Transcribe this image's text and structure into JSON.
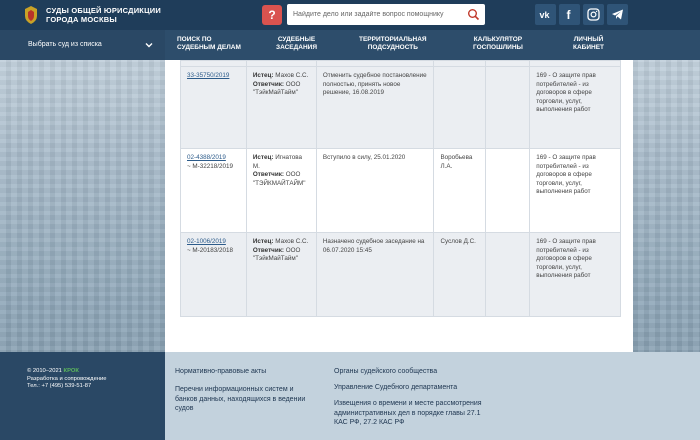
{
  "header": {
    "brand_line1": "СУДЫ ОБЩЕЙ ЮРИСДИКЦИИ",
    "brand_line2": "ГОРОДА МОСКВЫ",
    "help_label": "?",
    "search_placeholder": "Найдите дело или задайте вопрос помощнику",
    "social": [
      "vk-icon",
      "facebook-icon",
      "instagram-icon",
      "telegram-icon"
    ]
  },
  "nav": {
    "court_select": "Выбрать суд из списка",
    "items": [
      {
        "line1": "ПОИСК ПО",
        "line2": "СУДЕБНЫМ ДЕЛАМ"
      },
      {
        "line1": "СУДЕБНЫЕ",
        "line2": "ЗАСЕДАНИЯ"
      },
      {
        "line1": "ТЕРРИТОРИАЛЬНАЯ",
        "line2": "ПОДСУДНОСТЬ"
      },
      {
        "line1": "КАЛЬКУЛЯТОР",
        "line2": "ГОСПОШЛИНЫ"
      },
      {
        "line1": "ЛИЧНЫЙ",
        "line2": "КАБИНЕТ"
      }
    ]
  },
  "cases": [
    {
      "number": "33-35750/2019",
      "number_extra": "",
      "plaintiff_label": "Истец:",
      "plaintiff": "Махов С.С.",
      "defendant_label": "Ответчик:",
      "defendant": "ООО \"ТэйкМайТайм\"",
      "status": "Отменить судебное постановление полностью, принять новое решение, 16.08.2019",
      "judge": "",
      "category": "169 - О защите прав потребителей - из договоров в сфере торговли, услуг, выполнения работ"
    },
    {
      "number": "02-4388/2019",
      "number_extra": "~ М-32218/2019",
      "plaintiff_label": "Истец:",
      "plaintiff": "Игнатова М.",
      "defendant_label": "Ответчик:",
      "defendant": "ООО \"ТЭЙКМАЙТАЙМ\"",
      "status": "Вступило в силу, 25.01.2020",
      "judge": "Воробьева Л.А.",
      "category": "169 - О защите прав потребителей - из договоров в сфере торговли, услуг, выполнения работ"
    },
    {
      "number": "02-1006/2019",
      "number_extra": "~ М-20183/2018",
      "plaintiff_label": "Истец:",
      "plaintiff": "Махов С.С.",
      "defendant_label": "Ответчик:",
      "defendant": "ООО \"ТэйкМайТайм\"",
      "status": "Назначено судебное заседание на 06.07.2020 15:45",
      "judge": "Суслов Д.С.",
      "category": "169 - О защите прав потребителей - из договоров в сфере торговли, услуг, выполнения работ"
    }
  ],
  "footer": {
    "copyright_prefix": "© 2010–2021",
    "krok": "КРОК",
    "dev": "Разработка и сопровождение",
    "phone": "Тел.: +7 (495) 539-51-87",
    "links_col1": [
      "Нормативно-правовые акты",
      "Перечни информационных систем и банков данных, находящихся в ведении судов"
    ],
    "links_col2": [
      "Органы судейского сообщества",
      "Управление Судебного департамента",
      "Извещения о времени и месте рассмотрения административных дел в порядке главы 27.1 КАС РФ, 27.2 КАС РФ"
    ]
  },
  "colors": {
    "header_bg": "#1f3d5a",
    "nav_bg": "#2d4d6b",
    "help_red": "#d9534f",
    "link_blue": "#2c5b8a",
    "krok_green": "#5cb85c",
    "footer_bg": "#c3d2dd"
  }
}
